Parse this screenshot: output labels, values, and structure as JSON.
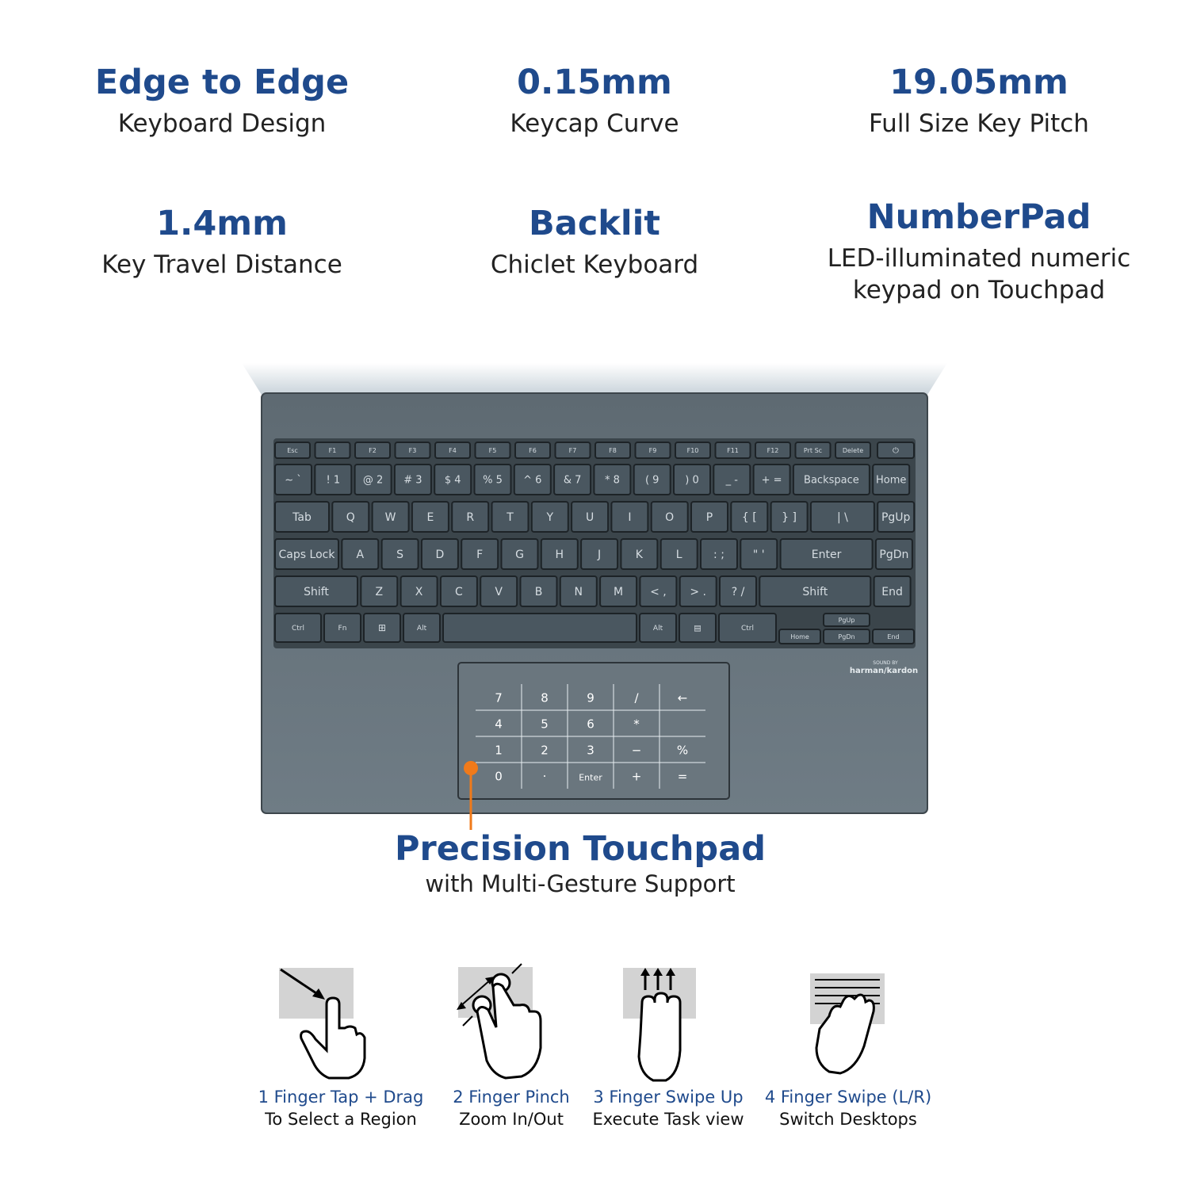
{
  "features": [
    {
      "title": "Edge to Edge",
      "subtitle": "Keyboard Design"
    },
    {
      "title": "0.15mm",
      "subtitle": "Keycap Curve"
    },
    {
      "title": "19.05mm",
      "subtitle": "Full Size Key Pitch"
    },
    {
      "title": "1.4mm",
      "subtitle": "Key Travel Distance"
    },
    {
      "title": "Backlit",
      "subtitle": "Chiclet Keyboard"
    },
    {
      "title": "NumberPad",
      "subtitle": "LED-illuminated numeric keypad on Touchpad"
    }
  ],
  "laptop": {
    "brand_line1": "SOUND BY",
    "brand_line2": "harman/kardon",
    "fn_row": [
      "Esc",
      "F1",
      "F2",
      "F3",
      "F4",
      "F5",
      "F6",
      "F7",
      "F8",
      "F9",
      "F10",
      "F11",
      "F12",
      "Prt Sc",
      "Delete"
    ],
    "num_row": [
      "~ `",
      "! 1",
      "@ 2",
      "# 3",
      "$ 4",
      "% 5",
      "^ 6",
      "& 7",
      "* 8",
      "( 9",
      ") 0",
      "_ -",
      "+ =",
      "Backspace",
      "Home"
    ],
    "row_q": [
      "Tab",
      "Q",
      "W",
      "E",
      "R",
      "T",
      "Y",
      "U",
      "I",
      "O",
      "P",
      "{ [",
      "} ]",
      "| \\",
      "PgUp"
    ],
    "row_a": [
      "Caps Lock",
      "A",
      "S",
      "D",
      "F",
      "G",
      "H",
      "J",
      "K",
      "L",
      ": ;",
      "\" '",
      "Enter",
      "PgDn"
    ],
    "row_z": [
      "Shift",
      "Z",
      "X",
      "C",
      "V",
      "B",
      "N",
      "M",
      "< ,",
      "> .",
      "? /",
      "Shift",
      "End"
    ],
    "row_bottom": [
      "Ctrl",
      "Fn",
      "⊞",
      "Alt",
      "",
      "Alt",
      "▤",
      "Ctrl",
      "Home",
      "PgUp",
      "PgDn",
      "End"
    ],
    "numberpad": [
      [
        "7",
        "8",
        "9",
        "/",
        "←"
      ],
      [
        "4",
        "5",
        "6",
        "*",
        ""
      ],
      [
        "1",
        "2",
        "3",
        "−",
        "%"
      ],
      [
        "0",
        "·",
        "Enter",
        "+",
        "="
      ]
    ]
  },
  "touchpad": {
    "title": "Precision Touchpad",
    "subtitle": "with Multi-Gesture Support"
  },
  "gestures": [
    {
      "line1": "1 Finger Tap + Drag",
      "line2": "To Select a Region",
      "icon": "one-finger-drag-icon"
    },
    {
      "line1": "2 Finger Pinch",
      "line2": "Zoom In/Out",
      "icon": "two-finger-pinch-icon"
    },
    {
      "line1": "3 Finger Swipe Up",
      "line2": "Execute Task view",
      "icon": "three-finger-swipe-up-icon"
    },
    {
      "line1": "4 Finger Swipe (L/R)",
      "line2": "Switch Desktops",
      "icon": "four-finger-swipe-icon"
    }
  ],
  "colors": {
    "accent": "#1f4a8c",
    "laptop_body": "#5b6770",
    "callout": "#f07a1a"
  }
}
